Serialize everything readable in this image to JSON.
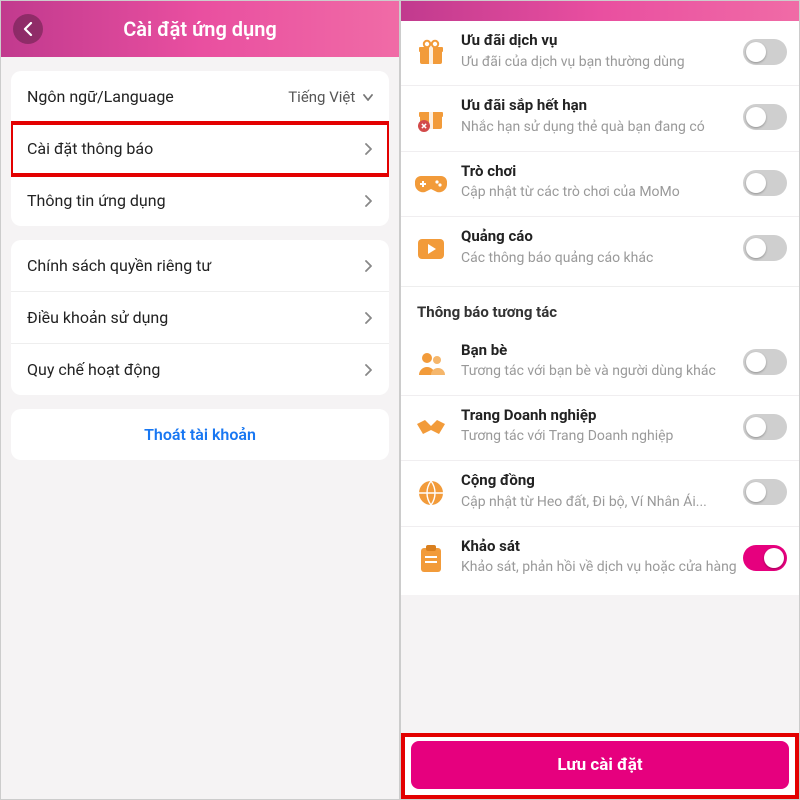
{
  "left": {
    "header_title": "Cài đặt ứng dụng",
    "rows": {
      "language_label": "Ngôn ngữ/Language",
      "language_value": "Tiếng Việt",
      "notif_label": "Cài đặt thông báo",
      "appinfo_label": "Thông tin ứng dụng",
      "privacy_label": "Chính sách quyền riêng tư",
      "terms_label": "Điều khoản sử dụng",
      "op_rules_label": "Quy chế hoạt động"
    },
    "logout_label": "Thoát tài khoản"
  },
  "right": {
    "items": [
      {
        "title": "Ưu đãi dịch vụ",
        "sub": "Ưu đãi của dịch vụ bạn thường dùng",
        "on": false
      },
      {
        "title": "Ưu đãi sắp hết hạn",
        "sub": "Nhắc hạn sử dụng thẻ quà bạn đang có",
        "on": false
      },
      {
        "title": "Trò chơi",
        "sub": "Cập nhật từ các trò chơi của MoMo",
        "on": false
      },
      {
        "title": "Quảng cáo",
        "sub": "Các thông báo quảng cáo khác",
        "on": false
      }
    ],
    "group_title": "Thông báo tương tác",
    "items2": [
      {
        "title": "Bạn bè",
        "sub": "Tương tác với bạn bè và người dùng khác",
        "on": false
      },
      {
        "title": "Trang Doanh nghiệp",
        "sub": "Tương tác với Trang Doanh nghiệp",
        "on": false
      },
      {
        "title": "Cộng đồng",
        "sub": "Cập nhật từ Heo đất, Đi bộ, Ví Nhân Ái...",
        "on": false
      },
      {
        "title": "Khảo sát",
        "sub": "Khảo sát, phản hồi về dịch vụ hoặc cửa hàng",
        "on": true
      }
    ],
    "save_label": "Lưu cài đặt"
  }
}
